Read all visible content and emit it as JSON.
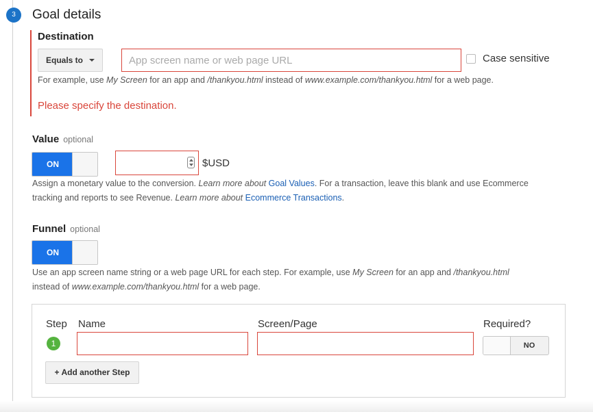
{
  "section": {
    "step_number": "3",
    "title": "Goal details"
  },
  "destination": {
    "label": "Destination",
    "match_type": "Equals to",
    "input_placeholder": "App screen name or web page URL",
    "input_value": "",
    "case_sensitive_label": "Case sensitive",
    "case_sensitive_checked": false,
    "help_parts": [
      "For example, use ",
      "My Screen",
      " for an app and ",
      "/thankyou.html",
      " instead of ",
      "www.example.com/thankyou.html",
      " for a web page."
    ],
    "error": "Please specify the destination."
  },
  "value": {
    "label": "Value",
    "optional": "optional",
    "toggle_label": "ON",
    "toggle_on": true,
    "amount": "",
    "currency": "$USD",
    "help_parts": [
      "Assign a monetary value to the conversion. ",
      "Learn more about ",
      "Goal Values",
      ". For a transaction, leave this blank and use Ecommerce",
      "tracking and reports to see Revenue. ",
      "Learn more about ",
      "Ecommerce Transactions",
      "."
    ]
  },
  "funnel": {
    "label": "Funnel",
    "optional": "optional",
    "toggle_label": "ON",
    "toggle_on": true,
    "help_parts": [
      "Use an app screen name string or a web page URL for each step. For example, use ",
      "My Screen",
      " for an app and ",
      "/thankyou.html",
      "instead of ",
      "www.example.com/thankyou.html",
      " for a web page."
    ],
    "columns": {
      "step": "Step",
      "name": "Name",
      "screen": "Screen/Page",
      "required": "Required?"
    },
    "steps": [
      {
        "number": "1",
        "name": "",
        "screen": "",
        "required_label": "NO",
        "required": false
      }
    ],
    "add_step_label": "+ Add another Step"
  },
  "colors": {
    "accent": "#1a73e8",
    "error": "#d9453a",
    "step_badge": "#1c73c7",
    "funnel_step": "#55b33f",
    "link": "#1a5fb4"
  }
}
